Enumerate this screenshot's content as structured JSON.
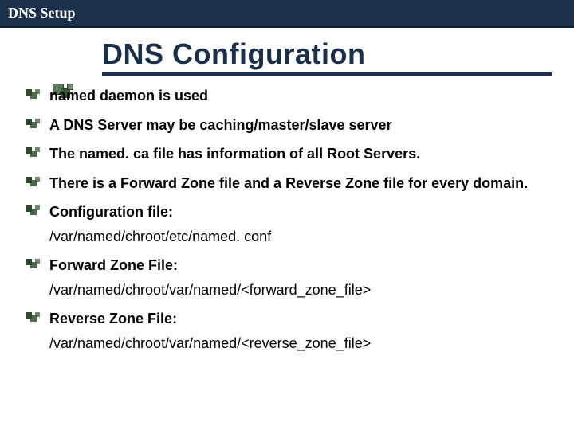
{
  "header": {
    "label": "DNS Setup"
  },
  "title": "DNS Configuration",
  "bullets": [
    {
      "text": "named daemon is used",
      "justify": false
    },
    {
      "text": "A DNS Server may be caching/master/slave server",
      "justify": false
    },
    {
      "text": "The named. ca file has information of all Root Servers.",
      "justify": true
    },
    {
      "text": "There is a Forward Zone file and a Reverse Zone file for every domain.",
      "justify": true
    },
    {
      "text": "Configuration file:",
      "sub": "/var/named/chroot/etc/named. conf"
    },
    {
      "text": "Forward Zone File:",
      "sub": "/var/named/chroot/var/named/<forward_zone_file>"
    },
    {
      "text": "Reverse Zone File:",
      "sub": "/var/named/chroot/var/named/<reverse_zone_file>"
    }
  ]
}
